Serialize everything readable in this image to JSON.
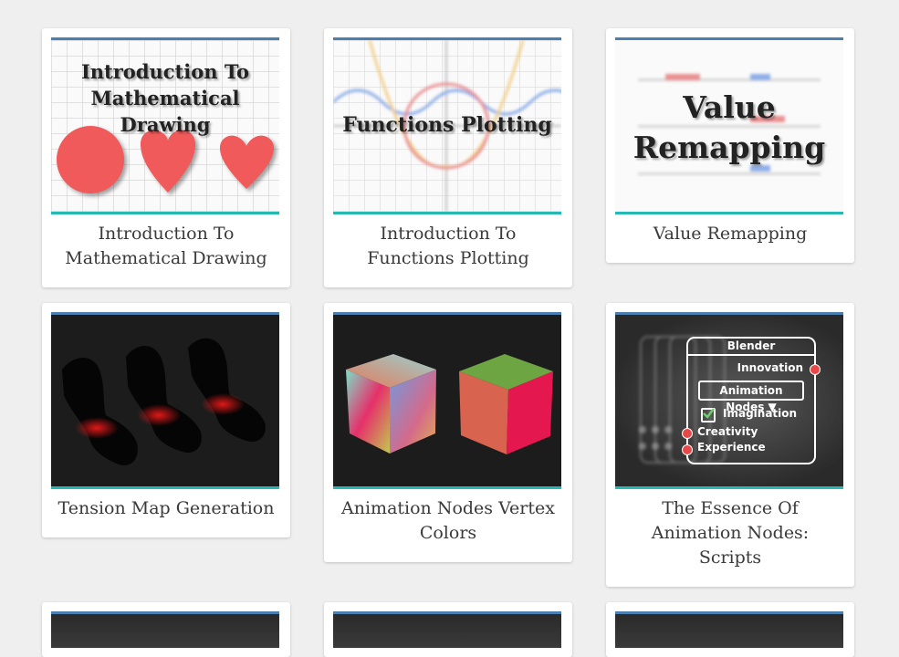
{
  "cards": [
    {
      "title_lines": [
        "Introduction To",
        "Mathematical Drawing"
      ],
      "thumb_text": [
        "Introduction To",
        "Mathematical Drawing"
      ]
    },
    {
      "title_lines": [
        "Introduction To",
        "Functions Plotting"
      ],
      "thumb_text": [
        "Functions Plotting"
      ]
    },
    {
      "title_lines": [
        "Value Remapping"
      ],
      "thumb_text": [
        "Value",
        "Remapping"
      ]
    },
    {
      "title_lines": [
        "Tension Map Generation"
      ]
    },
    {
      "title_lines": [
        "Animation Nodes Vertex",
        "Colors"
      ]
    },
    {
      "title_lines": [
        "The Essence Of",
        "Animation Nodes:",
        "Scripts"
      ],
      "node": {
        "header": "Blender",
        "output": "Innovation",
        "dropdown": "Animation Nodes ▼",
        "checkbox": "Imagination",
        "input1": "Creativity",
        "input2": "Experience"
      }
    }
  ],
  "colors": {
    "top_accent": "#4a7fb0",
    "bottom_accent": "#26b8b4",
    "shape": "#f05a5a"
  }
}
